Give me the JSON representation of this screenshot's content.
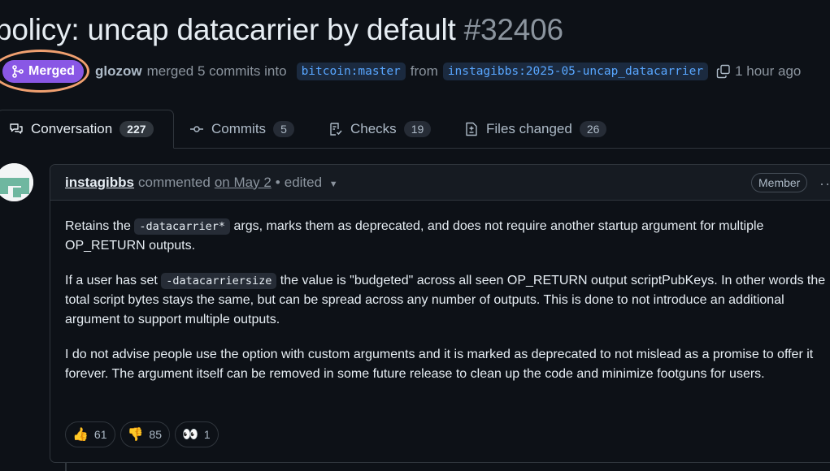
{
  "pr": {
    "title": "policy: uncap datacarrier by default",
    "number": "#32406",
    "status_label": "Merged",
    "author": "glozow",
    "merge_text": "merged 5 commits into",
    "base_branch": "bitcoin:master",
    "from_text": "from",
    "head_branch": "instagibbs:2025-05-uncap_datacarrier",
    "time_ago": "1 hour ago"
  },
  "tabs": [
    {
      "label": "Conversation",
      "count": "227",
      "icon": "comment-discussion-icon"
    },
    {
      "label": "Commits",
      "count": "5",
      "icon": "git-commit-icon"
    },
    {
      "label": "Checks",
      "count": "19",
      "icon": "checklist-icon"
    },
    {
      "label": "Files changed",
      "count": "26",
      "icon": "file-diff-icon"
    }
  ],
  "comment": {
    "author": "instagibbs",
    "action": "commented",
    "date": "on May 2",
    "separator": "•",
    "edited": "edited",
    "role": "Member",
    "p1_before": "Retains the",
    "p1_code": "-datacarrier*",
    "p1_after": "args, marks them as deprecated, and does not require another startup argument for multiple OP_RETURN outputs.",
    "p2_before": "If a user has set",
    "p2_code": "-datacarriersize",
    "p2_after": "the value is \"budgeted\" across all seen OP_RETURN output scriptPubKeys. In other words the total script bytes stays the same, but can be spread across any number of outputs. This is done to not introduce an additional argument to support multiple outputs.",
    "p3": "I do not advise people use the option with custom arguments and it is marked as deprecated to not mislead as a promise to offer it forever. The argument itself can be removed in some future release to clean up the code and minimize footguns for users."
  },
  "reactions": [
    {
      "emoji": "👍",
      "count": "61"
    },
    {
      "emoji": "👎",
      "count": "85"
    },
    {
      "emoji": "👀",
      "count": "1"
    }
  ],
  "colors": {
    "background": "#0d1117",
    "merged": "#8957e5",
    "highlight_ring": "#f0a070",
    "link": "#58a6ff"
  }
}
